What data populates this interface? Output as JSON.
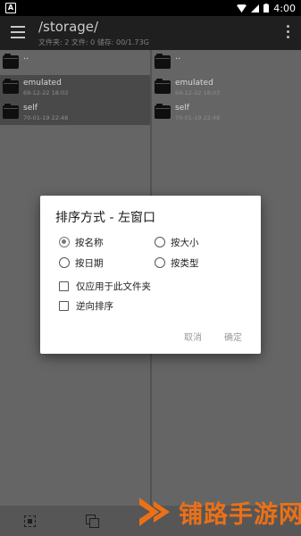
{
  "statusbar": {
    "notif": "A",
    "time": "4:00"
  },
  "appbar": {
    "path": "/storage/",
    "subtitle": "文件夹: 2  文件: 0  储存: 00/1.73G"
  },
  "left_pane": {
    "up_label": "..",
    "items": [
      {
        "name": "emulated",
        "date": "69-12-22 18:03"
      },
      {
        "name": "self",
        "date": "70-01-19 22:48"
      }
    ]
  },
  "right_pane": {
    "up_label": "..",
    "items": [
      {
        "name": "emulated",
        "date": "69-12-22 18:03"
      },
      {
        "name": "self",
        "date": "70-01-19 22:48"
      }
    ]
  },
  "dialog": {
    "title": "排序方式 - 左窗口",
    "options": [
      "按名称",
      "按大小",
      "按日期",
      "按类型"
    ],
    "selected": "按名称",
    "checks": [
      "仅应用于此文件夹",
      "逆向排序"
    ],
    "cancel": "取消",
    "ok": "确定"
  },
  "watermark": {
    "text": "铺路手游网",
    "color": "#ff7a1a"
  },
  "colors": {
    "background": "#6b6b6b",
    "appbar": "#222222",
    "selected_row": "#505050",
    "dialog": "#ffffff"
  }
}
